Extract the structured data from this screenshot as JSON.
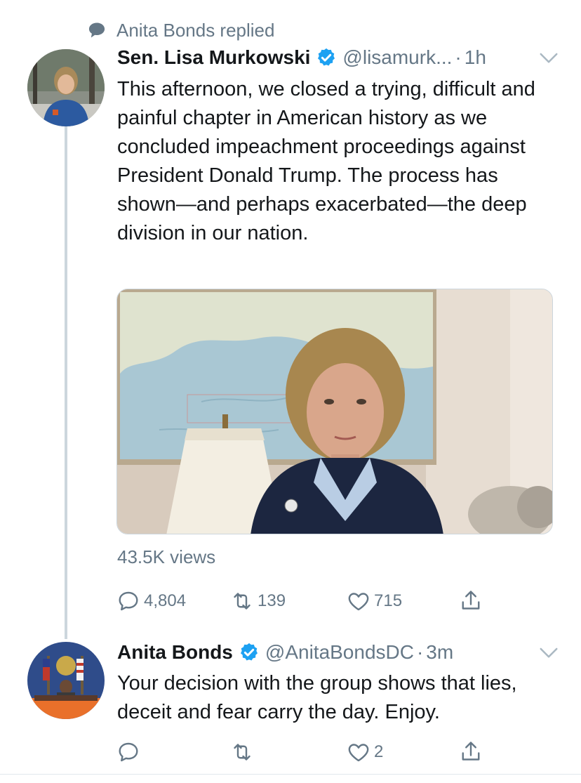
{
  "social_context": {
    "text": "Anita Bonds replied",
    "icon": "speech-bubble-icon"
  },
  "tweet1": {
    "display_name": "Sen. Lisa Murkowski",
    "verified": true,
    "handle": "@lisamurk...",
    "separator": "·",
    "time": "1h",
    "text": "This afternoon, we closed a trying, difficult and painful chapter in American history as we concluded impeachment proceedings against President Donald Trump. The process has shown—and perhaps exacerbated—the deep division in our nation.",
    "views": "43.5K views",
    "reply_count": "4,804",
    "retweet_count": "139",
    "like_count": "715",
    "video_progress": 0
  },
  "tweet2": {
    "display_name": "Anita Bonds",
    "verified": true,
    "handle": "@AnitaBondsDC",
    "separator": "·",
    "time": "3m",
    "text": "Your decision with the group shows that lies, deceit and fear carry the day.  Enjoy.",
    "reply_count": "",
    "retweet_count": "",
    "like_count": "2"
  },
  "colors": {
    "text": "#14171a",
    "secondary": "#657786",
    "verified_blue": "#1da1f2",
    "thread_line": "#ccd6dd",
    "divider": "#e1e8ed"
  }
}
